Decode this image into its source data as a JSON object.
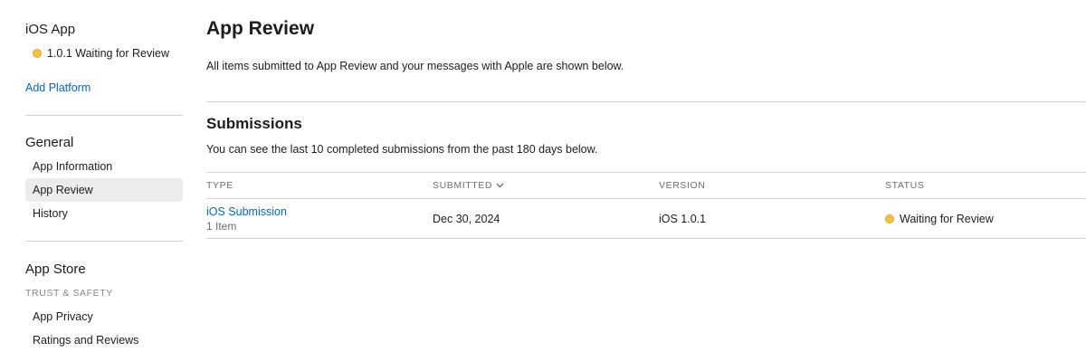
{
  "sidebar": {
    "app_title": "iOS App",
    "version_status": "1.0.1 Waiting for Review",
    "add_platform": "Add Platform",
    "general": {
      "heading": "General",
      "items": [
        "App Information",
        "App Review",
        "History"
      ],
      "active": "App Review"
    },
    "app_store": {
      "heading": "App Store",
      "caption": "TRUST & SAFETY",
      "items": [
        "App Privacy",
        "Ratings and Reviews"
      ]
    }
  },
  "main": {
    "title": "App Review",
    "description": "All items submitted to App Review and your messages with Apple are shown below.",
    "submissions": {
      "title": "Submissions",
      "description": "You can see the last 10 completed submissions from the past 180 days below.",
      "columns": {
        "type": "TYPE",
        "submitted": "SUBMITTED",
        "version": "VERSION",
        "status": "STATUS"
      },
      "rows": [
        {
          "type": "iOS Submission",
          "items": "1 Item",
          "submitted": "Dec 30, 2024",
          "version": "iOS 1.0.1",
          "status": "Waiting for Review"
        }
      ]
    }
  },
  "colors": {
    "link": "#0066cc",
    "status_waiting": "#f5c242",
    "divider": "#d2d2d7",
    "active_bg": "#ececed"
  },
  "icons": {
    "status_dot": "status-dot-icon",
    "sort": "chevron-down-icon"
  }
}
